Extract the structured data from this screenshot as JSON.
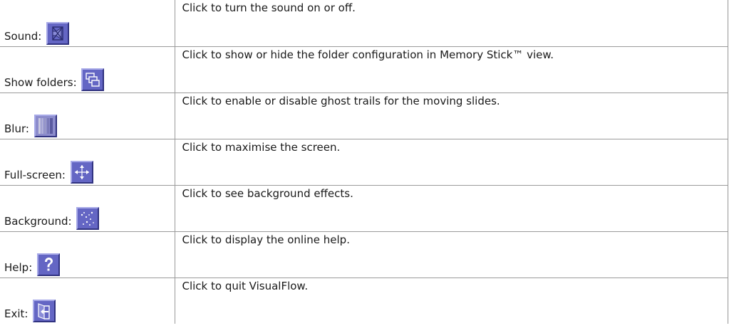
{
  "rows": [
    {
      "label": "Sound:",
      "icon": "sound-icon",
      "description": "Click to turn the sound on or off."
    },
    {
      "label": "Show folders:",
      "icon": "folders-icon",
      "description": "Click to show or hide the folder configuration in Memory Stick™ view."
    },
    {
      "label": "Blur:",
      "icon": "blur-icon",
      "description": "Click to enable or disable ghost trails for the moving slides."
    },
    {
      "label": "Full-screen:",
      "icon": "fullscreen-icon",
      "description": "Click to maximise the screen."
    },
    {
      "label": "Background:",
      "icon": "background-icon",
      "description": "Click to see background effects."
    },
    {
      "label": "Help:",
      "icon": "help-icon",
      "description": "Click to display the online help."
    },
    {
      "label": "Exit:",
      "icon": "exit-icon",
      "description": "Click to quit VisualFlow."
    }
  ],
  "colors": {
    "button_face": "#6466c4",
    "button_highlight": "#a8aae8",
    "button_shadow": "#303280",
    "table_border": "#9a9a9a"
  }
}
